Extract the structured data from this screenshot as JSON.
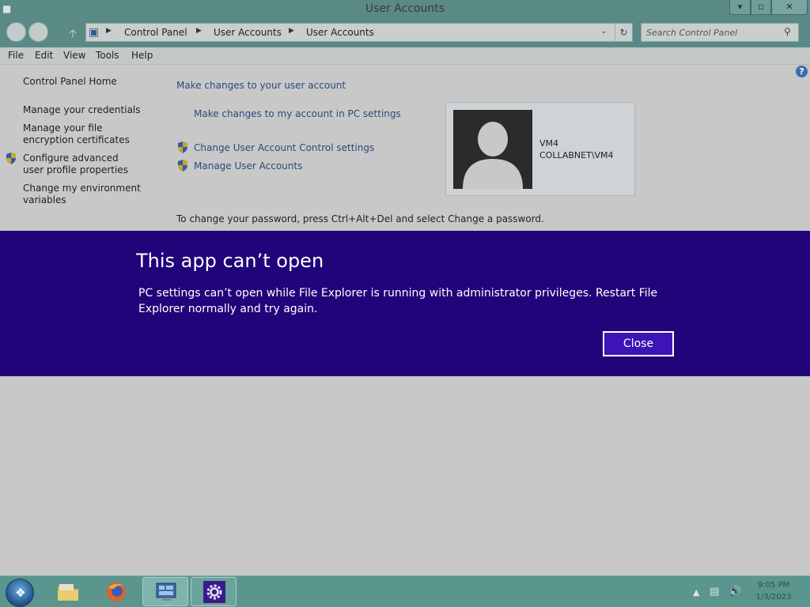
{
  "window": {
    "title": "User Accounts",
    "minimize_glyph": "▾",
    "maximize_glyph": "▫",
    "close_glyph": "✕"
  },
  "address": {
    "crumbs": [
      "Control Panel",
      "User Accounts",
      "User Accounts"
    ],
    "search_placeholder": "Search Control Panel"
  },
  "menu": {
    "items": [
      "File",
      "Edit",
      "View",
      "Tools",
      "Help"
    ]
  },
  "sidebar": {
    "items": [
      "Control Panel Home",
      "Manage your credentials",
      "Manage your file encryption certificates",
      "Configure advanced user profile properties",
      "Change my environment variables"
    ]
  },
  "main": {
    "heading": "Make changes to your user account",
    "links": [
      "Make changes to my account in PC settings",
      "Change User Account Control settings",
      "Manage User Accounts"
    ],
    "password_hint": "To change your password, press Ctrl+Alt+Del and select Change a password."
  },
  "user": {
    "name": "VM4",
    "domain": "COLLABNET\\VM4"
  },
  "dialog": {
    "title": "This app can’t open",
    "message": "PC settings can’t open while File Explorer is running with administrator privileges. Restart File Explorer normally and try again.",
    "close_label": "Close",
    "background_color": "#21037a"
  },
  "taskbar": {
    "pinned": [
      "file-explorer-icon",
      "firefox-icon",
      "control-panel-icon",
      "settings-gear-icon"
    ],
    "active_index": 2,
    "clock_time": "9:05 PM",
    "clock_date": "1/3/2023"
  }
}
